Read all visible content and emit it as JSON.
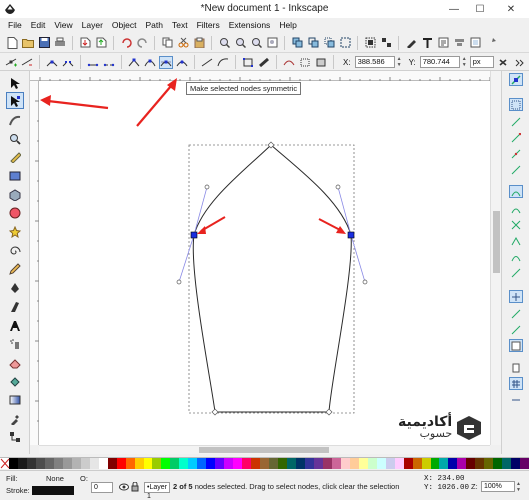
{
  "window": {
    "title": "*New document 1 - Inkscape",
    "minimize": "—",
    "maximize": "☐",
    "close": "✕"
  },
  "menu": [
    "File",
    "Edit",
    "View",
    "Layer",
    "Object",
    "Path",
    "Text",
    "Filters",
    "Extensions",
    "Help"
  ],
  "tool_controls": {
    "x_label": "X:",
    "x_value": "388.586",
    "y_label": "Y:",
    "y_value": "780.744",
    "unit": "px"
  },
  "tooltip": "Make selected nodes symmetric",
  "rulers": {
    "h_ticks": [
      "100",
      "0",
      "|100",
      "200",
      "300",
      "400",
      "500",
      "600",
      "700"
    ],
    "v_ticks": [
      "100",
      "200",
      "300"
    ]
  },
  "logo": {
    "line1": "أكاديمية",
    "line2": "حسوب"
  },
  "status": {
    "fill_label": "Fill:",
    "fill_value": "None",
    "stroke_label": "Stroke:",
    "opacity_label": "O:",
    "opacity_value": "0",
    "layer": "•Layer 1",
    "message_bold": "2 of 5",
    "message": "nodes selected. Drag to select nodes, click clear the selection",
    "x_label": "X:",
    "x_value": "234.00",
    "y_label": "Y:",
    "y_value": "1026.00",
    "zoom_label": "Z:",
    "zoom_value": "100%"
  },
  "colors": {
    "node_selected": "#1a2ee0",
    "handle_line": "#8a8ae6",
    "arrow": "#e8231f",
    "path": "#2a2a2a",
    "tool_active_bg": "#cfe3f7"
  }
}
